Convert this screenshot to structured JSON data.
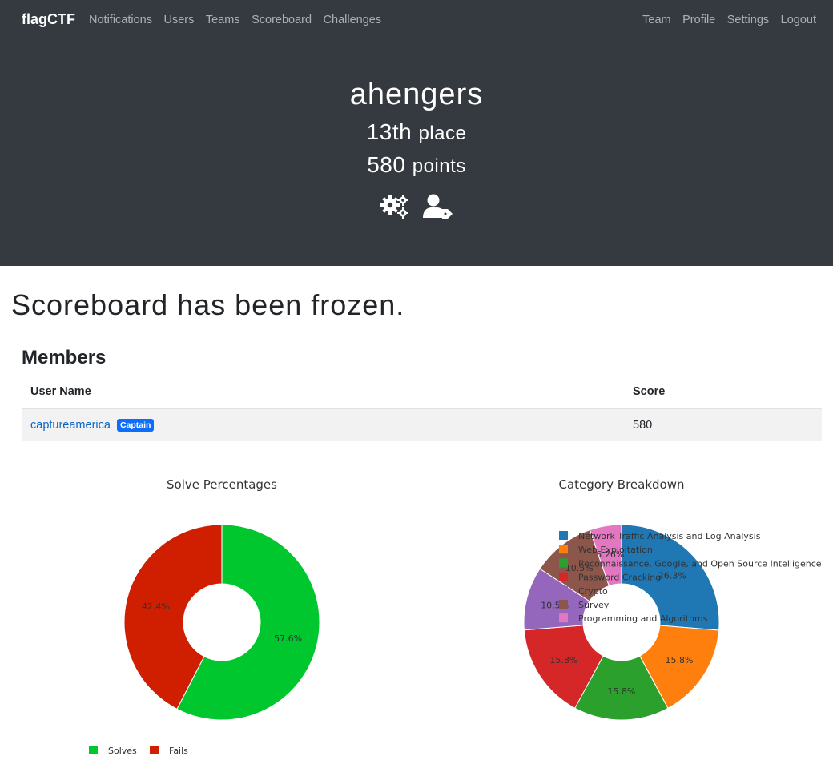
{
  "navbar": {
    "brand": "flagCTF",
    "left_links": [
      "Notifications",
      "Users",
      "Teams",
      "Scoreboard",
      "Challenges"
    ],
    "right_links": [
      "Team",
      "Profile",
      "Settings",
      "Logout"
    ]
  },
  "team": {
    "name": "ahengers",
    "place": "13th",
    "place_suffix": "place",
    "points": "580",
    "points_suffix": "points",
    "icons": [
      "cogs-icon",
      "user-tag-icon"
    ]
  },
  "notice": "Scoreboard has been frozen.",
  "members": {
    "title": "Members",
    "columns": [
      "User Name",
      "Score"
    ],
    "rows": [
      {
        "name": "captureamerica",
        "badge": "Captain",
        "score": "580"
      }
    ]
  },
  "chart_data": [
    {
      "type": "pie",
      "title": "Solve Percentages",
      "labels": [
        "Solves",
        "Fails"
      ],
      "values": [
        57.6,
        42.4
      ],
      "slice_labels": [
        "57.6%",
        "42.4%"
      ],
      "colors": [
        "#00c72e",
        "#cf1e00"
      ],
      "hole": true,
      "legend_position": "bottom"
    },
    {
      "type": "pie",
      "title": "Category Breakdown",
      "labels": [
        "Network Traffic Analysis and Log Analysis",
        "Web Exploitation",
        "Reconnaissance, Google, and Open Source Intelligence",
        "Password Cracking",
        "Crypto",
        "Survey",
        "Programming and Algorithms"
      ],
      "values": [
        26.3,
        15.8,
        15.8,
        15.8,
        10.5,
        10.5,
        5.26
      ],
      "slice_labels": [
        "26.3%",
        "15.8%",
        "15.8%",
        "15.8%",
        "10.5%",
        "10.5%",
        "5.26%"
      ],
      "colors": [
        "#1f77b4",
        "#ff7f0e",
        "#2ca02c",
        "#d62728",
        "#9467bd",
        "#8c564b",
        "#e377c2"
      ],
      "hole": true,
      "legend_position": "top-right"
    }
  ]
}
